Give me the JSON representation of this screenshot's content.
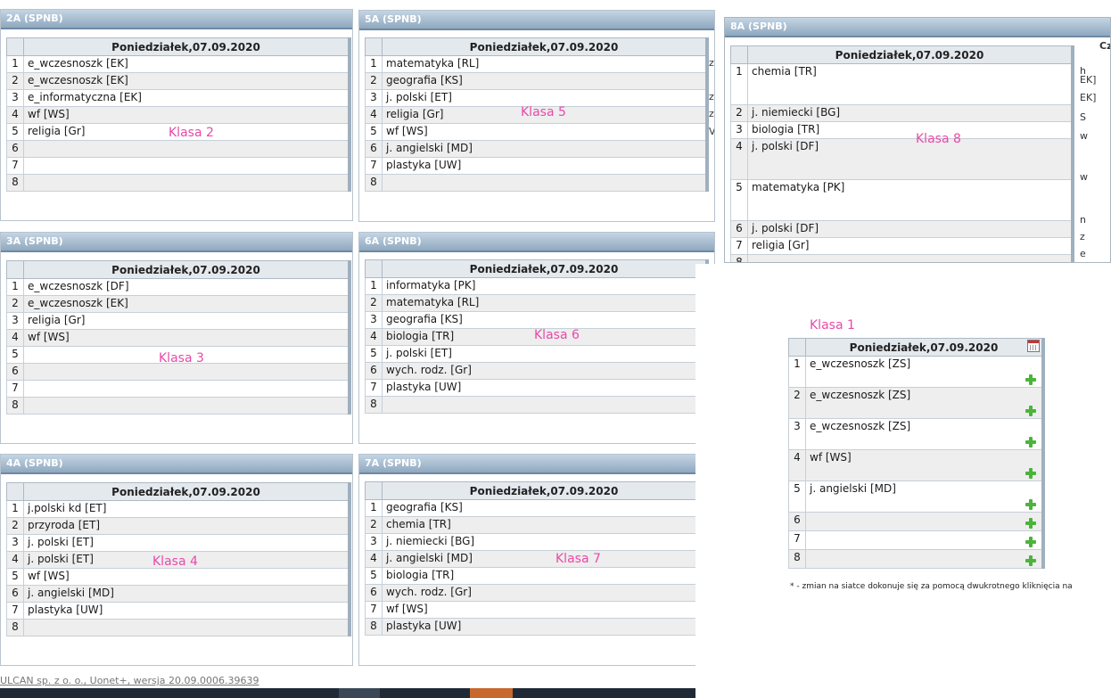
{
  "day_header": "Poniedziałek,07.09.2020",
  "panels": {
    "p2a": {
      "title": "2A (SPNB)",
      "label": "Klasa 2",
      "rows": [
        "e_wczesnoszk [EK]",
        "e_wczesnoszk [EK]",
        "e_informatyczna [EK]",
        "wf [WS]",
        "religia [Gr]",
        "",
        "",
        ""
      ]
    },
    "p3a": {
      "title": "3A (SPNB)",
      "label": "Klasa 3",
      "rows": [
        "e_wczesnoszk [DF]",
        "e_wczesnoszk [EK]",
        "religia [Gr]",
        "wf [WS]",
        "",
        "",
        "",
        ""
      ]
    },
    "p4a": {
      "title": "4A (SPNB)",
      "label": "Klasa 4",
      "rows": [
        "j.polski kd [ET]",
        "przyroda [ET]",
        "j. polski [ET]",
        "j. polski [ET]",
        "wf [WS]",
        "j. angielski [MD]",
        "plastyka [UW]",
        ""
      ]
    },
    "p5a": {
      "title": "5A (SPNB)",
      "label": "Klasa 5",
      "rows": [
        "matematyka [RL]",
        "geografia [KS]",
        "j. polski [ET]",
        "religia [Gr]",
        "wf [WS]",
        "j. angielski [MD]",
        "plastyka [UW]",
        ""
      ],
      "edge": [
        "ze",
        "",
        "ze",
        "ze",
        "VS",
        "",
        "",
        ""
      ]
    },
    "p6a": {
      "title": "6A (SPNB)",
      "label": "Klasa 6",
      "rows": [
        "informatyka [PK]",
        "matematyka [RL]",
        "geografia [KS]",
        "biologia [TR]",
        "j. polski [ET]",
        "wych. rodz. [Gr]",
        "plastyka [UW]",
        ""
      ]
    },
    "p7a": {
      "title": "7A (SPNB)",
      "label": "Klasa 7",
      "rows": [
        "geografia [KS]",
        "chemia [TR]",
        "j. niemiecki [BG]",
        "j. angielski [MD]",
        "biologia [TR]",
        "wych. rodz. [Gr]",
        "wf [WS]",
        "plastyka [UW]"
      ]
    },
    "p8a": {
      "title": "8A (SPNB)",
      "label": "Klasa 8",
      "rows": [
        "chemia [TR]",
        "j. niemiecki [BG]",
        "biologia [TR]",
        "j. polski [DF]",
        "matematyka [PK]",
        "j. polski [DF]",
        "religia [Gr]",
        ""
      ],
      "edge": [
        "h",
        "EK]",
        "S",
        "w",
        "w",
        "n",
        "z",
        "e"
      ],
      "edge_head": "Cz",
      "edge_top": "EK]"
    },
    "p1a": {
      "label": "Klasa 1",
      "rows": [
        "e_wczesnoszk [ZS]",
        "e_wczesnoszk [ZS]",
        "e_wczesnoszk [ZS]",
        "wf [WS]",
        "j. angielski [MD]",
        "",
        "",
        ""
      ],
      "note": "* - zmian na siatce dokonuje się za pomocą dwukrotnego kliknięcia na"
    }
  },
  "footer": "ULCAN sp. z o. o., Uonet+, wersja 20.09.0006.39639",
  "colors": {
    "accent_label": "#e84aa8",
    "header_blue": "#8fa8bf",
    "plus_green": "#4bb43a"
  }
}
